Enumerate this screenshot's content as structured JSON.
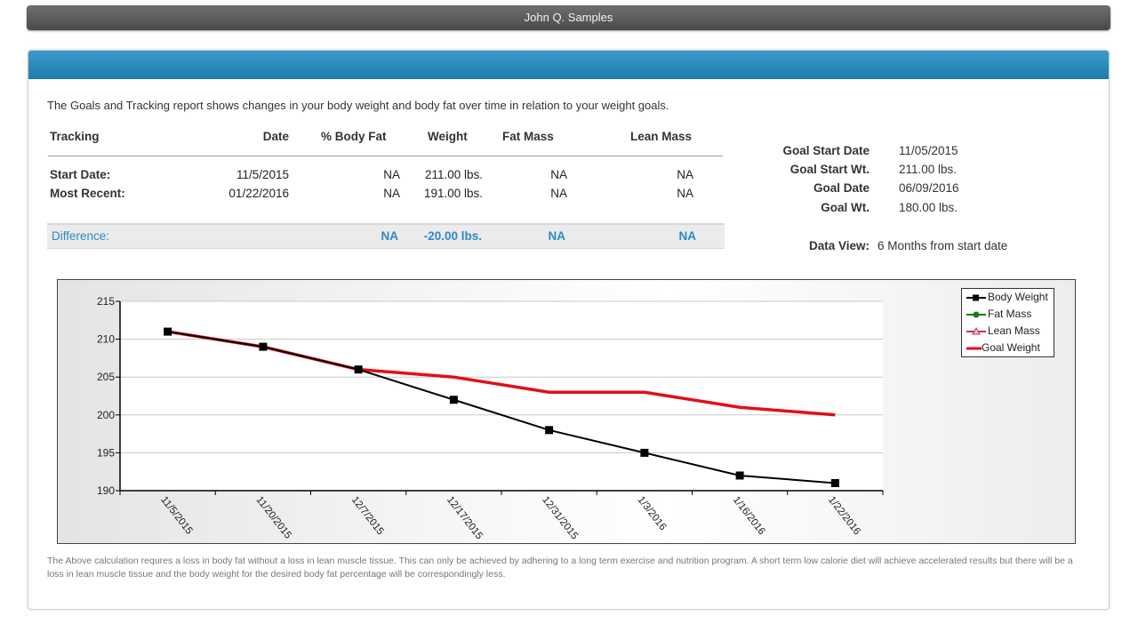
{
  "header": {
    "user_name": "John Q. Samples"
  },
  "intro": "The Goals and Tracking report shows changes in your body weight and body fat over time in relation to your weight goals.",
  "tracking_table": {
    "headers": [
      "Tracking",
      "Date",
      "% Body Fat",
      "Weight",
      "Fat Mass",
      "Lean Mass"
    ],
    "rows": [
      {
        "label": "Start Date:",
        "date": "11/5/2015",
        "body_fat": "NA",
        "weight": "211.00 lbs.",
        "fat_mass": "NA",
        "lean_mass": "NA"
      },
      {
        "label": "Most Recent:",
        "date": "01/22/2016",
        "body_fat": "NA",
        "weight": "191.00 lbs.",
        "fat_mass": "NA",
        "lean_mass": "NA"
      }
    ],
    "difference": {
      "label": "Difference:",
      "body_fat": "NA",
      "weight": "-20.00 lbs.",
      "fat_mass": "NA",
      "lean_mass": "NA"
    }
  },
  "goals": [
    {
      "label": "Goal Start Date",
      "value": "11/05/2015"
    },
    {
      "label": "Goal Start Wt.",
      "value": "211.00 lbs."
    },
    {
      "label": "Goal Date",
      "value": "06/09/2016"
    },
    {
      "label": "Goal Wt.",
      "value": "180.00 lbs."
    }
  ],
  "data_view": {
    "label": "Data View:",
    "value": "6 Months from start date"
  },
  "chart_data": {
    "type": "line",
    "categories": [
      "11/5/2015",
      "11/20/2015",
      "12/7/2015",
      "12/17/2015",
      "12/31/2015",
      "1/3/2016",
      "1/16/2016",
      "1/22/2016"
    ],
    "ylim": [
      190,
      215
    ],
    "yticks": [
      190,
      195,
      200,
      205,
      210,
      215
    ],
    "grid": true,
    "legend_position": "top-right",
    "series": [
      {
        "name": "Body Weight",
        "color": "#000000",
        "marker": "square",
        "values": [
          211,
          209,
          206,
          202,
          198,
          195,
          192,
          191
        ]
      },
      {
        "name": "Fat Mass",
        "color": "#1a7a1a",
        "marker": "circle",
        "values": []
      },
      {
        "name": "Lean Mass",
        "color": "#c0306a",
        "marker": "triangle",
        "values": []
      },
      {
        "name": "Goal Weight",
        "color": "#e0101a",
        "marker": "none",
        "values": [
          211,
          209,
          206,
          205,
          203,
          203,
          201,
          200
        ]
      }
    ]
  },
  "footnote": "The Above calculation requres a loss in body fat without a loss in lean muscle tissue. This can only be achieved by adhering to a long term exercise and nutrition program. A short term low calorie diet will achieve accelerated results but there will be a loss in lean muscle tissue and the body weight for the desired body fat percentage will be correspondingly less."
}
